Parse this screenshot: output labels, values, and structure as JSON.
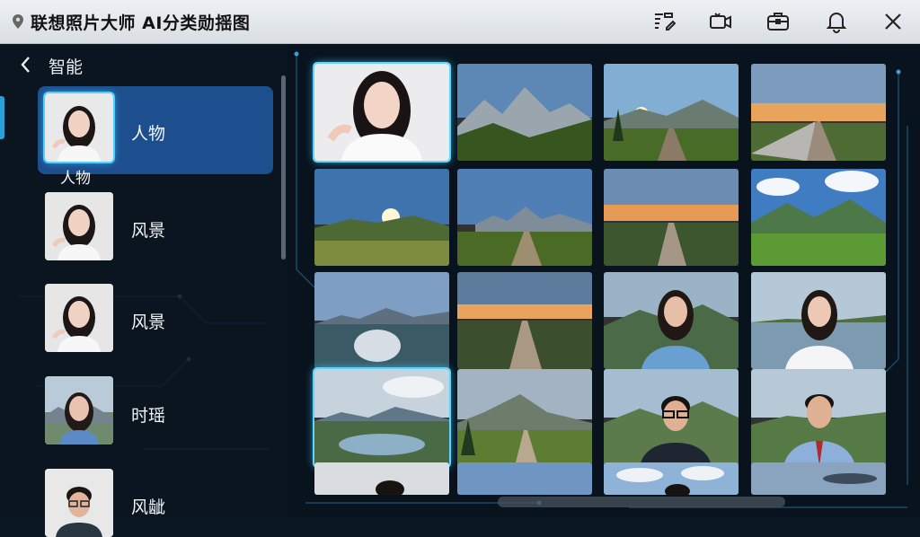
{
  "app": {
    "title": "联想照片大师 AI分类勋揺图"
  },
  "toolbar": {
    "icons": [
      "filter-edit-icon",
      "video-camera-icon",
      "briefcase-icon",
      "bell-icon",
      "close-icon"
    ]
  },
  "sidebar": {
    "title": "智能",
    "selected_caption": "人物",
    "items": [
      {
        "label": "人物",
        "thumb": "woman-portrait"
      },
      {
        "label": "风景",
        "thumb": "woman-portrait"
      },
      {
        "label": "风景",
        "thumb": "woman-portrait"
      },
      {
        "label": "时瑶",
        "thumb": "woman-outdoor"
      },
      {
        "label": "风龇",
        "thumb": "man-glasses"
      }
    ]
  },
  "grid": {
    "rows": [
      [
        "portrait-woman",
        "mountains-peaks",
        "road-sunrise",
        "long-road-sunset"
      ],
      [
        "meadow-sunrise",
        "mountain-range",
        "road-horizon",
        "green-hills-clouds"
      ],
      [
        "lake-mountains",
        "road-sunset",
        "woman-valley",
        "woman-lake"
      ],
      [
        "lake-reflection",
        "mountain-path",
        "man-glasses-outdoor",
        "man-suit-outdoor"
      ],
      [
        "partial-portrait",
        "sky-partial",
        "man-partial",
        "sky-clouds-partial"
      ]
    ]
  },
  "colors": {
    "accent": "#2a9fd8",
    "selection": "#1d4f8e",
    "glow": "#4fd0ff"
  }
}
